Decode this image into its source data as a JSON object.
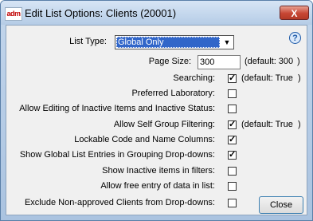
{
  "window": {
    "app_icon_text": "adm",
    "title": "Edit List Options: Clients (20001)",
    "close_label": "X"
  },
  "help_label": "?",
  "list_type": {
    "label": "List Type:",
    "value": "Global Only"
  },
  "page_size": {
    "label": "Page Size:",
    "value": "300",
    "default_note": "(default: 300",
    "close_paren": ")"
  },
  "options": [
    {
      "label": "Searching:",
      "checked": true,
      "checkmark": "✓",
      "default_note": "(default: True",
      "close_paren": ")"
    },
    {
      "label": "Preferred Laboratory:",
      "checked": false,
      "checkmark": ""
    },
    {
      "label": "Allow Editing of Inactive Items and Inactive Status:",
      "checked": false,
      "checkmark": ""
    },
    {
      "label": "Allow Self Group Filtering:",
      "checked": true,
      "checkmark": "✓",
      "default_note": "(default: True",
      "close_paren": ")"
    },
    {
      "label": "Lockable Code and Name Columns:",
      "checked": true,
      "checkmark": "✓"
    },
    {
      "label": "Show Global List Entries in Grouping Drop-downs:",
      "checked": true,
      "checkmark": "✓"
    },
    {
      "label": "Show Inactive items in filters:",
      "checked": false,
      "checkmark": ""
    },
    {
      "label": "Allow free entry of data in list:",
      "checked": false,
      "checkmark": ""
    },
    {
      "label": "Exclude Non-approved Clients from Drop-downs:",
      "checked": false,
      "checkmark": ""
    }
  ],
  "close_button": "Close"
}
